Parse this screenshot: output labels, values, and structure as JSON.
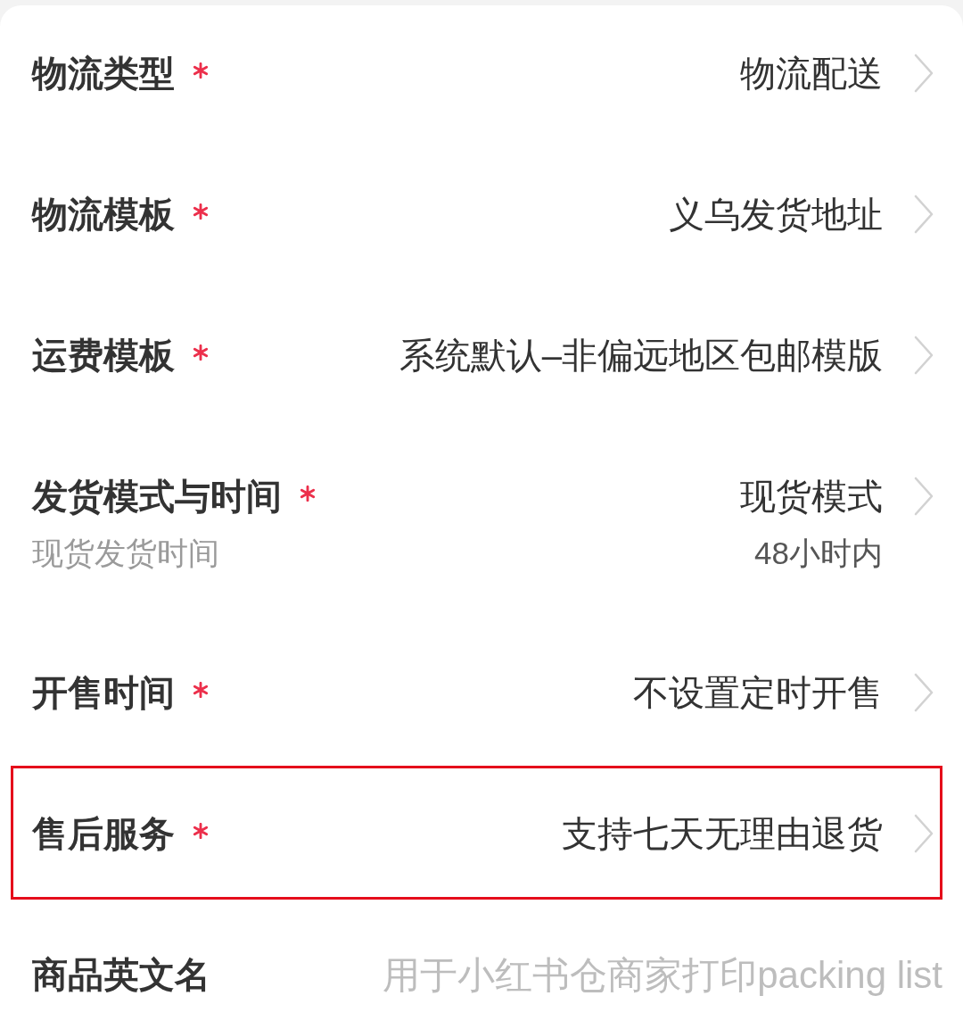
{
  "rows": [
    {
      "kind": "select",
      "label": "物流类型",
      "required": true,
      "value": "物流配送",
      "highlighted": false
    },
    {
      "kind": "select",
      "label": "物流模板",
      "required": true,
      "value": "义乌发货地址",
      "highlighted": false
    },
    {
      "kind": "select",
      "label": "运费模板",
      "required": true,
      "value": "系统默认–非偏远地区包邮模版",
      "highlighted": false
    },
    {
      "kind": "select",
      "label": "发货模式与时间",
      "required": true,
      "value": "现货模式",
      "sublabel": "现货发货时间",
      "subvalue": "48小时内",
      "highlighted": false
    },
    {
      "kind": "select",
      "label": "开售时间",
      "required": true,
      "value": "不设置定时开售",
      "highlighted": false
    },
    {
      "kind": "select",
      "label": "售后服务",
      "required": true,
      "value": "支持七天无理由退货",
      "highlighted": true
    },
    {
      "kind": "input",
      "label": "商品英文名",
      "required": false,
      "placeholder": "用于小红书仓商家打印packing list",
      "highlighted": false
    }
  ]
}
